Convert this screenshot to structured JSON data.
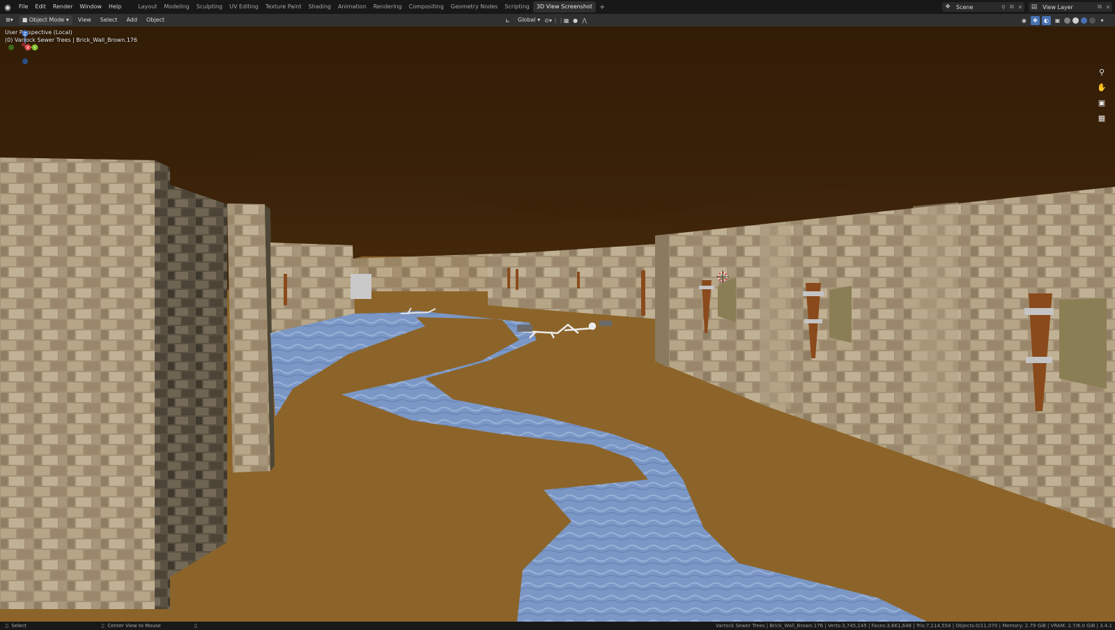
{
  "app": {
    "logo_icon": "blender-logo-icon"
  },
  "menu": [
    "File",
    "Edit",
    "Render",
    "Window",
    "Help"
  ],
  "workspaces": {
    "tabs": [
      "Layout",
      "Modeling",
      "Sculpting",
      "UV Editing",
      "Texture Paint",
      "Shading",
      "Animation",
      "Rendering",
      "Compositing",
      "Geometry Nodes",
      "Scripting",
      "3D View Screenshot"
    ],
    "active": "3D View Screenshot",
    "add_label": "+"
  },
  "scene": {
    "name": "Scene"
  },
  "view_layer": {
    "name": "View Layer"
  },
  "header": {
    "mode": "Object Mode",
    "menus": [
      "View",
      "Select",
      "Add",
      "Object"
    ],
    "orientation": "Global"
  },
  "viewport": {
    "perspective_label": "User Perspective (Local)",
    "object_info": "(0) Varrock Sewer Trees | Brick_Wall_Brown.176",
    "gizmo_axes": {
      "x": "X",
      "y": "Y",
      "z": "Z"
    }
  },
  "status": {
    "left_action": "Select",
    "middle_action": "Center View to Mouse",
    "stats": "Varrock Sewer Trees | Brick_Wall_Brown.176 | Verts:3,745,145 | Faces:3,661,648 | Tris:7,114,554 | Objects:0/11,070 | Memory: 2.79 GiB | VRAM: 2.7/6.0 GiB | 3.4.1"
  },
  "colors": {
    "ceiling": "#4a2c0c",
    "floor": "#8a6328",
    "water": "#7a96c4",
    "wall": "#a8977a",
    "torch": "#8a4a1c",
    "accent": "#4772b3"
  }
}
